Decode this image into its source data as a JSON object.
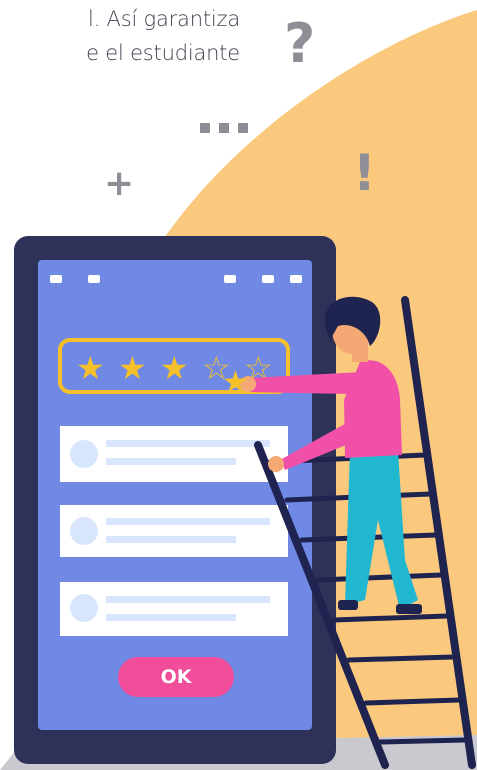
{
  "text": {
    "line1": "l. Así garantiza",
    "line2": "e el estudiante"
  },
  "rating": {
    "filled_stars": 3,
    "total_stars": 5,
    "star_glyph_filled": "★",
    "star_glyph_empty": "☆"
  },
  "decorations": {
    "question": "?",
    "plus": "+",
    "exclamation": "!",
    "ellipsis": "■■■"
  },
  "phone": {
    "ok_label": "OK"
  },
  "colors": {
    "blob": "#fbc97d",
    "phone_frame": "#2e3258",
    "phone_screen": "#6f89e4",
    "star": "#f5c02a",
    "ok_button": "#f04e9a",
    "shirt": "#f050a8",
    "pants": "#21b7d0",
    "hair": "#1f2350",
    "skin": "#f4a974",
    "ladder": "#1f2350",
    "shadow": "#c9c9cf",
    "card": "#ffffff",
    "card_line": "#cfe0fb"
  }
}
